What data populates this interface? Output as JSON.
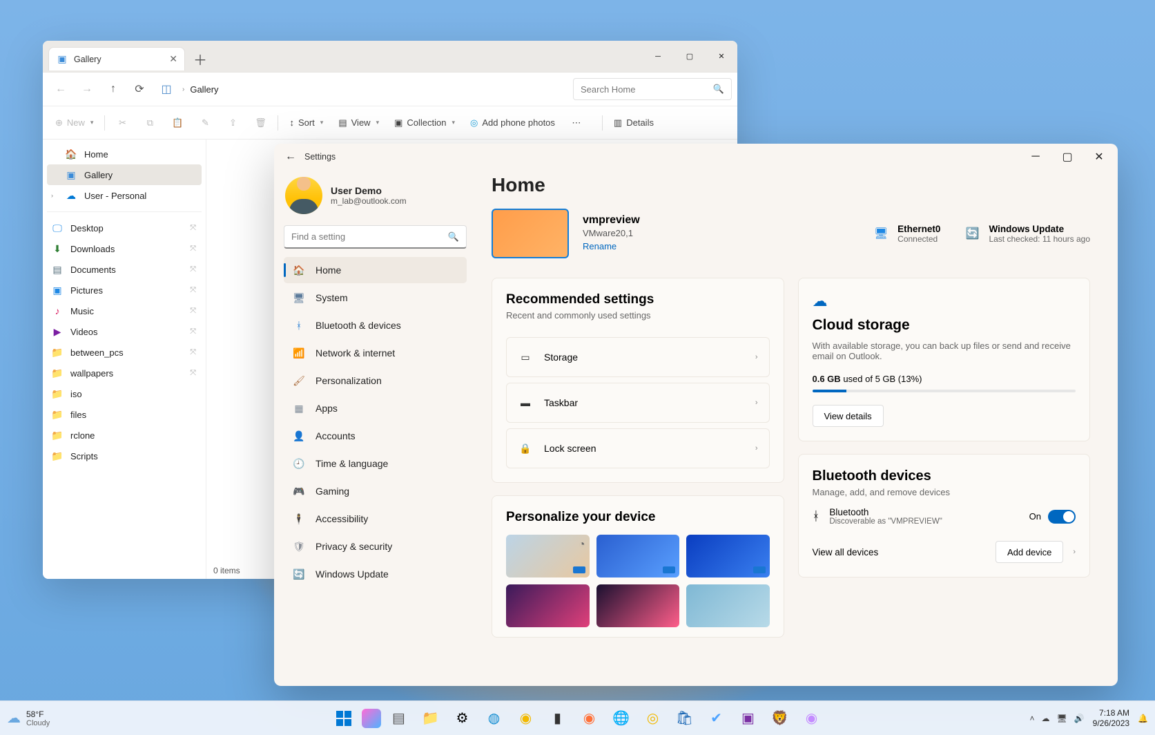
{
  "explorer": {
    "tab_title": "Gallery",
    "crumb": "Gallery",
    "search_placeholder": "Search Home",
    "cmd": {
      "new": "New",
      "sort": "Sort",
      "view": "View",
      "collection": "Collection",
      "addphone": "Add phone photos",
      "details": "Details"
    },
    "side": {
      "q0": "Home",
      "q1": "Gallery",
      "q2": "User - Personal",
      "p0": "Desktop",
      "p1": "Downloads",
      "p2": "Documents",
      "p3": "Pictures",
      "p4": "Music",
      "p5": "Videos",
      "p6": "between_pcs",
      "p7": "wallpapers",
      "p8": "iso",
      "p9": "files",
      "p10": "rclone",
      "p11": "Scripts"
    },
    "status": "0 items"
  },
  "settings": {
    "title": "Settings",
    "user": {
      "name": "User Demo",
      "email": "m_lab@outlook.com"
    },
    "search_placeholder": "Find a setting",
    "nav": {
      "home": "Home",
      "system": "System",
      "bt": "Bluetooth & devices",
      "net": "Network & internet",
      "pers": "Personalization",
      "apps": "Apps",
      "acc": "Accounts",
      "time": "Time & language",
      "game": "Gaming",
      "a11y": "Accessibility",
      "priv": "Privacy & security",
      "wu": "Windows Update"
    },
    "page_title": "Home",
    "device": {
      "name": "vmpreview",
      "model": "VMware20,1",
      "rename": "Rename"
    },
    "eth": {
      "label": "Ethernet0",
      "sub": "Connected"
    },
    "wu": {
      "label": "Windows Update",
      "sub": "Last checked: 11 hours ago"
    },
    "rec": {
      "title": "Recommended settings",
      "sub": "Recent and commonly used settings",
      "storage": "Storage",
      "taskbar": "Taskbar",
      "lock": "Lock screen"
    },
    "pers": {
      "title": "Personalize your device"
    },
    "cloud": {
      "title": "Cloud storage",
      "desc": "With available storage, you can back up files or send and receive email on Outlook.",
      "used": "0.6 GB",
      "total": "used of 5 GB (13%)",
      "percent": 13,
      "btn": "View details"
    },
    "btc": {
      "title": "Bluetooth devices",
      "sub": "Manage, add, and remove devices",
      "label": "Bluetooth",
      "disc": "Discoverable as \"VMPREVIEW\"",
      "state": "On",
      "viewall": "View all devices",
      "add": "Add device"
    }
  },
  "taskbar": {
    "temp": "58°F",
    "cond": "Cloudy",
    "time": "7:18 AM",
    "date": "9/26/2023"
  }
}
